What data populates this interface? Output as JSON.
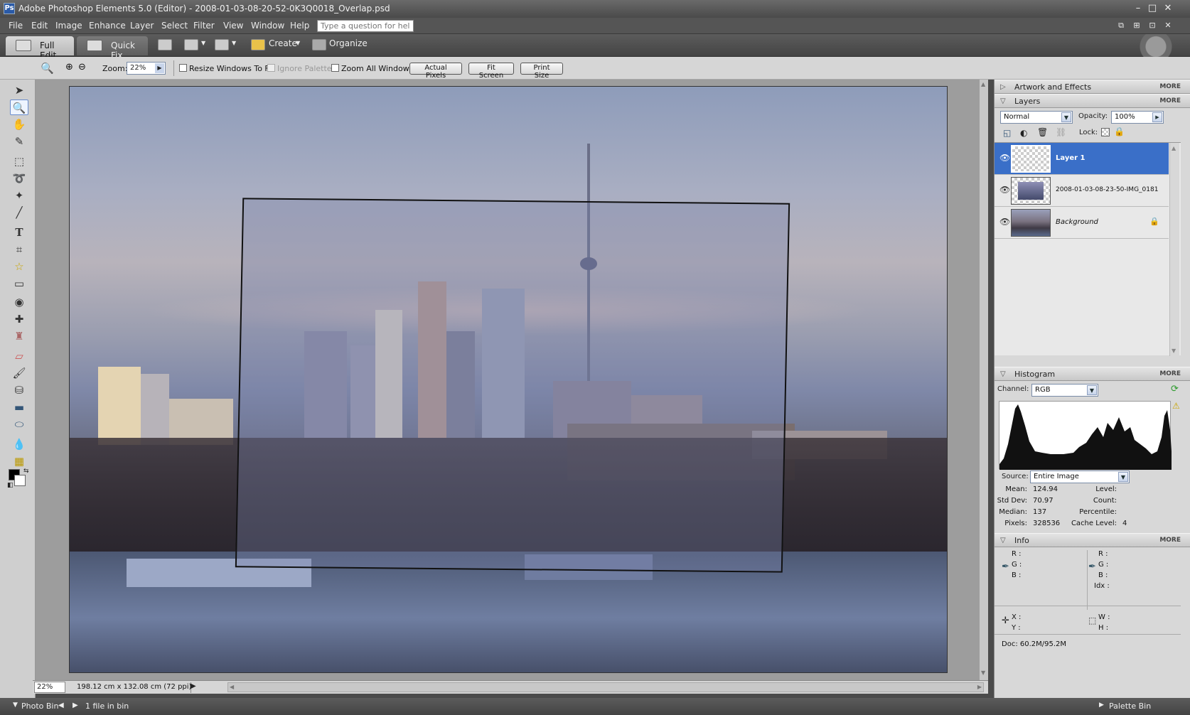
{
  "window": {
    "title": "Adobe Photoshop Elements 5.0 (Editor) - 2008-01-03-08-20-52-0K3Q0018_Overlap.psd",
    "app_icon": "Ps",
    "controls": [
      "minimize-icon",
      "maximize-icon",
      "close-icon"
    ]
  },
  "menu": {
    "items": [
      "File",
      "Edit",
      "Image",
      "Enhance",
      "Layer",
      "Select",
      "Filter",
      "View",
      "Window",
      "Help"
    ],
    "help_placeholder": "Type a question for help"
  },
  "modebar": {
    "full_edit": "Full Edit",
    "quick_fix": "Quick Fix",
    "create": "Create",
    "organize": "Organize"
  },
  "options": {
    "zoom_label": "Zoom:",
    "zoom_value": "22%",
    "resize_windows": "Resize Windows To Fit",
    "ignore_palettes": "Ignore Palettes",
    "zoom_all_windows": "Zoom All Windows",
    "actual_pixels": "Actual Pixels",
    "fit_screen": "Fit Screen",
    "print_size": "Print Size"
  },
  "status": {
    "zoom": "22%",
    "dimensions": "198.12 cm x 132.08 cm (72 ppi)"
  },
  "bottom": {
    "photo_bin": "Photo Bin",
    "files": "1 file in bin",
    "palette_bin": "Palette Bin"
  },
  "palettes": {
    "artwork": {
      "title": "Artwork and Effects",
      "more": "MORE"
    },
    "layers": {
      "title": "Layers",
      "more": "MORE",
      "blend_mode": "Normal",
      "opacity_label": "Opacity:",
      "opacity_value": "100%",
      "lock_label": "Lock:",
      "items": [
        {
          "name": "Layer 1",
          "active": true
        },
        {
          "name": "2008-01-03-08-23-50-IMG_0181",
          "active": false
        },
        {
          "name": "Background",
          "active": false,
          "locked": true
        }
      ]
    },
    "histogram": {
      "title": "Histogram",
      "more": "MORE",
      "channel_label": "Channel:",
      "channel_value": "RGB",
      "source_label": "Source:",
      "source_value": "Entire Image",
      "stats": {
        "mean_label": "Mean:",
        "mean": "124.94",
        "std_label": "Std Dev:",
        "std": "70.97",
        "median_label": "Median:",
        "median": "137",
        "pixels_label": "Pixels:",
        "pixels": "328536",
        "level_label": "Level:",
        "count_label": "Count:",
        "percentile_label": "Percentile:",
        "cache_label": "Cache Level:",
        "cache": "4"
      }
    },
    "info": {
      "title": "Info",
      "more": "MORE",
      "r": "R :",
      "g": "G :",
      "b": "B :",
      "idx": "Idx :",
      "x": "X :",
      "y": "Y :",
      "w": "W :",
      "h": "H :",
      "doc": "Doc: 60.2M/95.2M"
    }
  }
}
